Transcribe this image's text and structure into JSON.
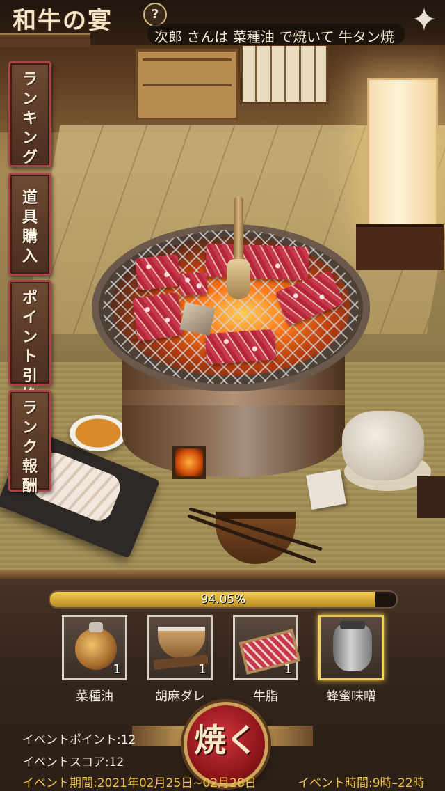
{
  "header": {
    "logo_text": "和牛の宴",
    "help_label": "?",
    "ticker_text": "次郎 さんは 菜種油 で焼いて 牛タン焼",
    "star_label": "✦"
  },
  "side_menu": [
    {
      "label": "ランキング",
      "active": false
    },
    {
      "label": "道具購入",
      "active": true
    },
    {
      "label": "ポイント引換",
      "active": false
    },
    {
      "label": "ランク報酬",
      "active": false
    }
  ],
  "progress": {
    "value_fraction": 0.9405,
    "text": "94.05%"
  },
  "items": [
    {
      "name": "菜種油",
      "count": "1",
      "icon": "rapeseed-oil-icon",
      "selected": false
    },
    {
      "name": "胡麻ダレ",
      "count": "1",
      "icon": "sesame-sauce-icon",
      "selected": false
    },
    {
      "name": "牛脂",
      "count": "1",
      "icon": "beef-fat-icon",
      "selected": false
    },
    {
      "name": "蜂蜜味噌",
      "count": "",
      "icon": "honey-miso-icon",
      "selected": true
    }
  ],
  "action_button": {
    "label": "焼く"
  },
  "event": {
    "points": "イベントポイント:12",
    "score": "イベントスコア:12",
    "period": "イベント期間:2021年02月25日~02月28日",
    "hours": "イベント時間:9時–22時"
  },
  "colors": {
    "accent_gold": "#f0c44a",
    "button_red": "#a01c22",
    "selected_border": "#f2cf5a"
  }
}
